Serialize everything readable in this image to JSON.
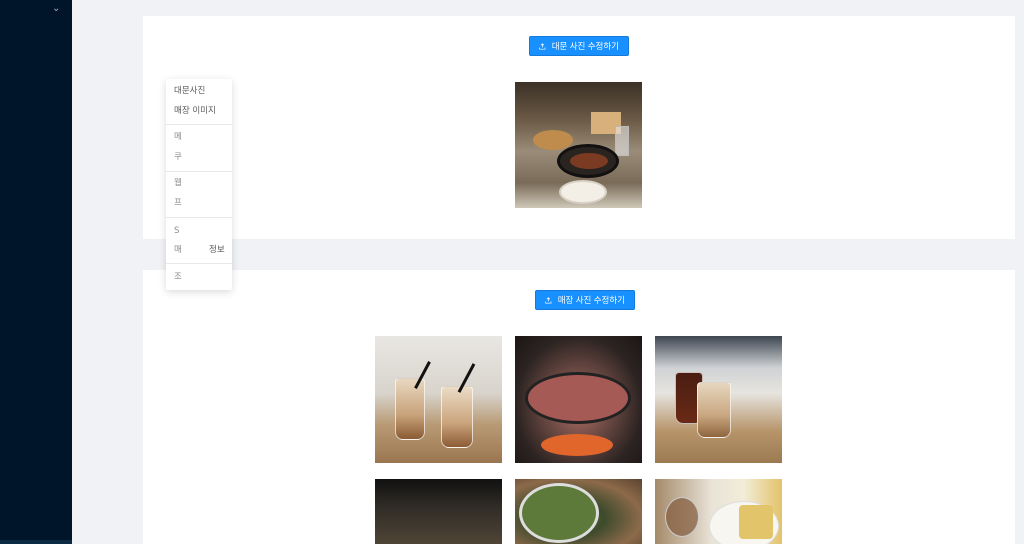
{
  "sidebar": {
    "collapse_icon": "chevron-down-icon"
  },
  "sections": {
    "main_photo": {
      "upload_button": {
        "label": "대문 사진 수정하기",
        "icon": "upload-icon"
      },
      "photo_alt": "대문 사진"
    },
    "store_photos": {
      "upload_button": {
        "label": "매장 사진 수정하기",
        "icon": "upload-icon"
      },
      "photos": [
        "iced latte",
        "grilled pork",
        "iced coffee",
        "dish",
        "salad",
        "cake"
      ]
    }
  },
  "anchor_menu": {
    "items": [
      {
        "label": "대문사진"
      },
      {
        "label": "매장 이미지"
      },
      {
        "label": "메"
      },
      {
        "label": "쿠"
      },
      {
        "label": "웹"
      },
      {
        "label": "프"
      },
      {
        "label": "S"
      },
      {
        "label": "매"
      },
      {
        "label": "조"
      }
    ],
    "visible_suffix": "정보"
  },
  "colors": {
    "primary": "#1890ff",
    "sider": "#001529",
    "background": "#f0f2f5"
  }
}
